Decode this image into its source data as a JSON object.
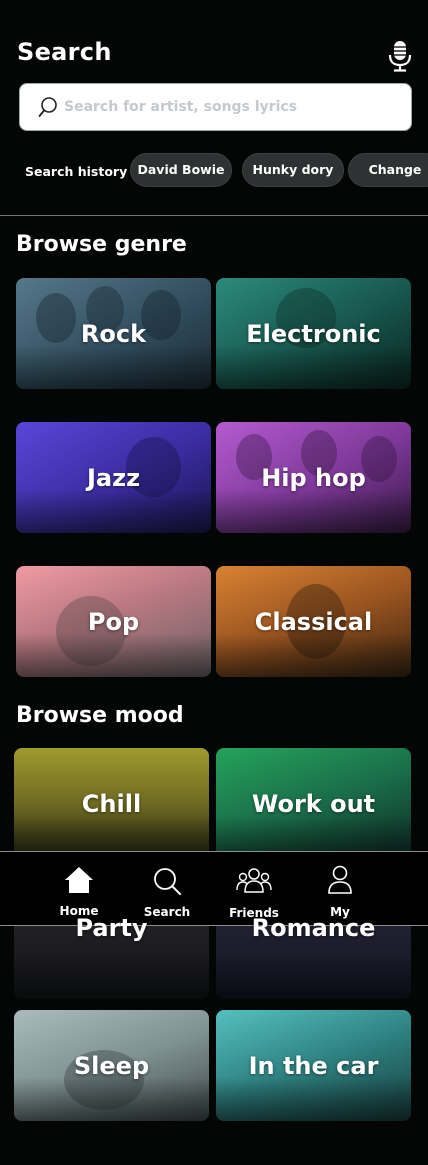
{
  "header": {
    "title": "Search"
  },
  "search": {
    "placeholder": "Search for artist, songs lyrics"
  },
  "history": {
    "label": "Search history",
    "chips": [
      "David Bowie",
      "Hunky dory",
      "Change"
    ]
  },
  "genre": {
    "title": "Browse genre",
    "cards": [
      {
        "label": "Rock"
      },
      {
        "label": "Electronic"
      },
      {
        "label": "Jazz"
      },
      {
        "label": "Hip hop"
      },
      {
        "label": "Pop"
      },
      {
        "label": "Classical"
      }
    ]
  },
  "mood": {
    "title": "Browse mood",
    "cards": [
      {
        "label": "Chill"
      },
      {
        "label": "Work out"
      },
      {
        "label": "Party"
      },
      {
        "label": "Romance"
      },
      {
        "label": "Sleep"
      },
      {
        "label": "In the car"
      }
    ]
  },
  "nav": {
    "items": [
      {
        "label": "Home",
        "icon": "home-icon"
      },
      {
        "label": "Search",
        "icon": "search-icon"
      },
      {
        "label": "Friends",
        "icon": "friends-icon"
      },
      {
        "label": "My",
        "icon": "profile-icon"
      }
    ]
  },
  "colors": {
    "background": "#030605",
    "chip": "#2e3232",
    "rock": "#3c5a6c",
    "electronic": "#1f6b60",
    "jazz": "#4536b8",
    "hiphop": "#9446b0",
    "pop": "#d8878e",
    "classical": "#b86a26",
    "chill": "#8b8a2c",
    "workout": "#1c8a4a",
    "sleep": "#8fa3a6",
    "inthecar": "#3fa6a6"
  }
}
